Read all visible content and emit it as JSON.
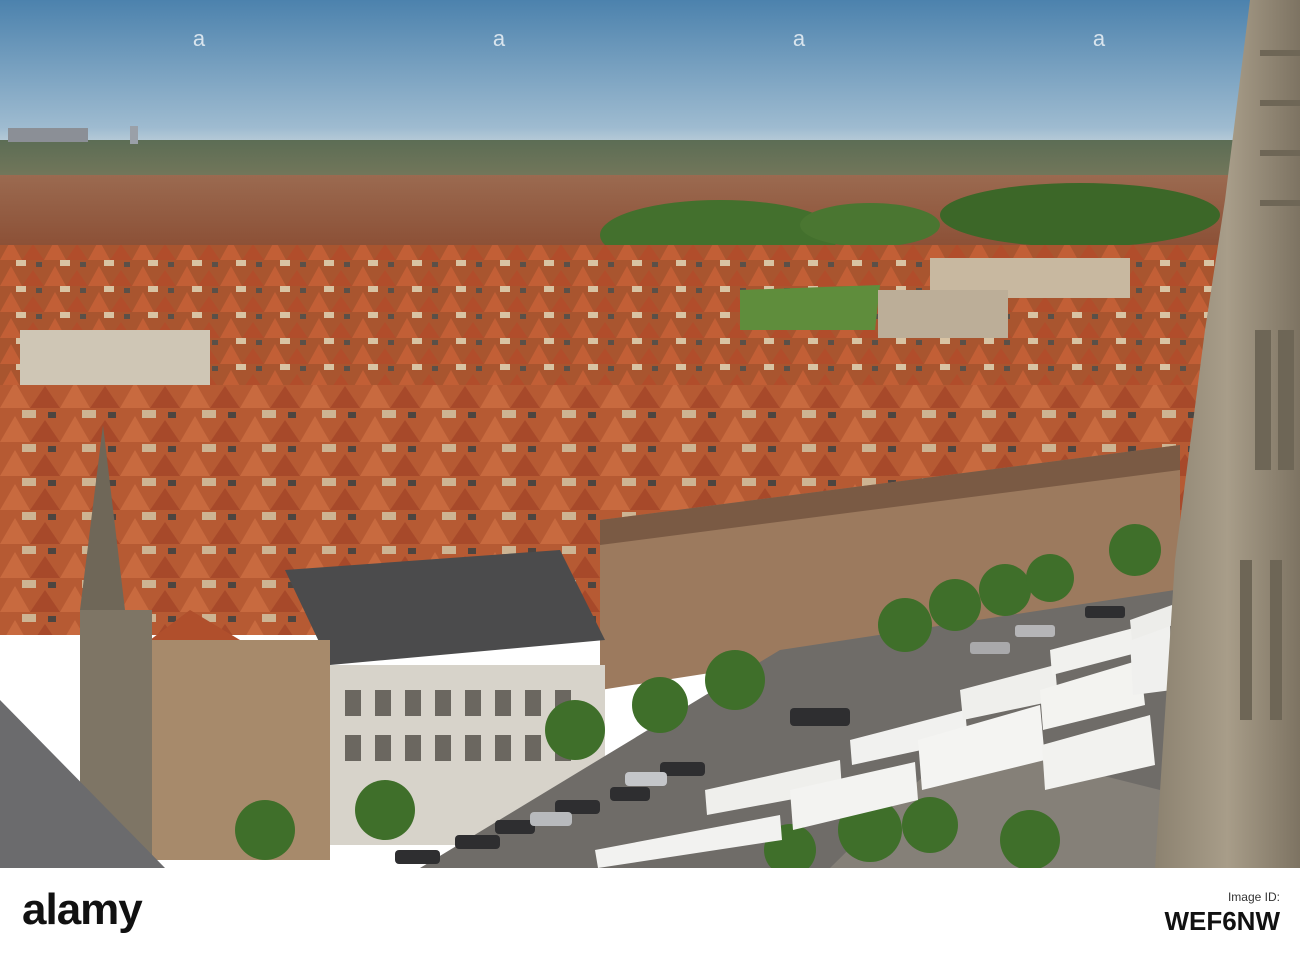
{
  "photo": {
    "alt": "Aerial view over Ypres (Ieper) rooftops and market square with parked coaches",
    "colors": {
      "sky_top": "#4e83ad",
      "sky_horizon": "#c4d5e0",
      "roof": "#b8532f",
      "tower_stone": "#9d917d",
      "bus_white": "#f2f2f0",
      "square": "#6f6c68",
      "tree": "#3f6f2a"
    }
  },
  "watermark": {
    "text": "a"
  },
  "footer": {
    "logo": "alamy",
    "id_label": "Image ID:",
    "id_value": "WEF6NW"
  }
}
